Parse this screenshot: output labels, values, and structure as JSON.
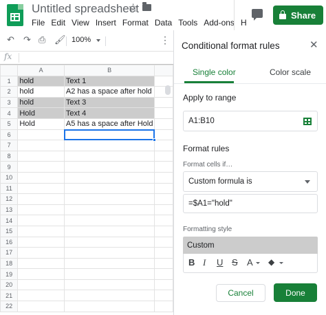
{
  "app": {
    "title": "Untitled spreadsheet",
    "menu": [
      "File",
      "Edit",
      "View",
      "Insert",
      "Format",
      "Data",
      "Tools",
      "Add-ons",
      "H"
    ],
    "share_label": "Share",
    "accent_color": "#188038"
  },
  "toolbar": {
    "zoom": "100%",
    "icons": [
      "undo-icon",
      "redo-icon",
      "print-icon",
      "paint-format-icon",
      "more-icon"
    ]
  },
  "formula_bar": {
    "fx_label": "fx"
  },
  "sheet": {
    "columns": [
      "A",
      "B"
    ],
    "rows": [
      {
        "num": "1",
        "a": "hold",
        "b": "Text 1",
        "highlight": true
      },
      {
        "num": "2",
        "a": "hold",
        "b": "A2 has a space after hold",
        "highlight": false
      },
      {
        "num": "3",
        "a": "hold",
        "b": "Text 3",
        "highlight": true
      },
      {
        "num": "4",
        "a": "Hold",
        "b": "Text 4",
        "highlight": true
      },
      {
        "num": "5",
        "a": "Hold",
        "b": "A5 has a space after Hold",
        "highlight": false
      },
      {
        "num": "6",
        "a": "",
        "b": "",
        "highlight": false
      },
      {
        "num": "7",
        "a": "",
        "b": "",
        "highlight": false
      },
      {
        "num": "8",
        "a": "",
        "b": "",
        "highlight": false
      },
      {
        "num": "9",
        "a": "",
        "b": "",
        "highlight": false
      },
      {
        "num": "10",
        "a": "",
        "b": "",
        "highlight": false
      },
      {
        "num": "11",
        "a": "",
        "b": "",
        "highlight": false
      },
      {
        "num": "12",
        "a": "",
        "b": "",
        "highlight": false
      },
      {
        "num": "13",
        "a": "",
        "b": "",
        "highlight": false
      },
      {
        "num": "14",
        "a": "",
        "b": "",
        "highlight": false
      },
      {
        "num": "15",
        "a": "",
        "b": "",
        "highlight": false
      },
      {
        "num": "16",
        "a": "",
        "b": "",
        "highlight": false
      },
      {
        "num": "17",
        "a": "",
        "b": "",
        "highlight": false
      },
      {
        "num": "18",
        "a": "",
        "b": "",
        "highlight": false
      },
      {
        "num": "19",
        "a": "",
        "b": "",
        "highlight": false
      },
      {
        "num": "20",
        "a": "",
        "b": "",
        "highlight": false
      },
      {
        "num": "21",
        "a": "",
        "b": "",
        "highlight": false
      },
      {
        "num": "22",
        "a": "",
        "b": "",
        "highlight": false
      }
    ],
    "highlight_color": "#cccccc",
    "selected_cell": "B6"
  },
  "panel": {
    "title": "Conditional format rules",
    "tabs": {
      "single": "Single color",
      "scale": "Color scale"
    },
    "apply_label": "Apply to range",
    "range_value": "A1:B10",
    "format_rules_label": "Format rules",
    "format_cells_if_label": "Format cells if…",
    "condition_value": "Custom formula is",
    "formula_value": "=$A1=\"hold\"",
    "formatting_style_label": "Formatting style",
    "style_preview_label": "Custom",
    "style_tools": [
      "B",
      "I",
      "U",
      "S",
      "A"
    ],
    "cancel_label": "Cancel",
    "done_label": "Done"
  }
}
